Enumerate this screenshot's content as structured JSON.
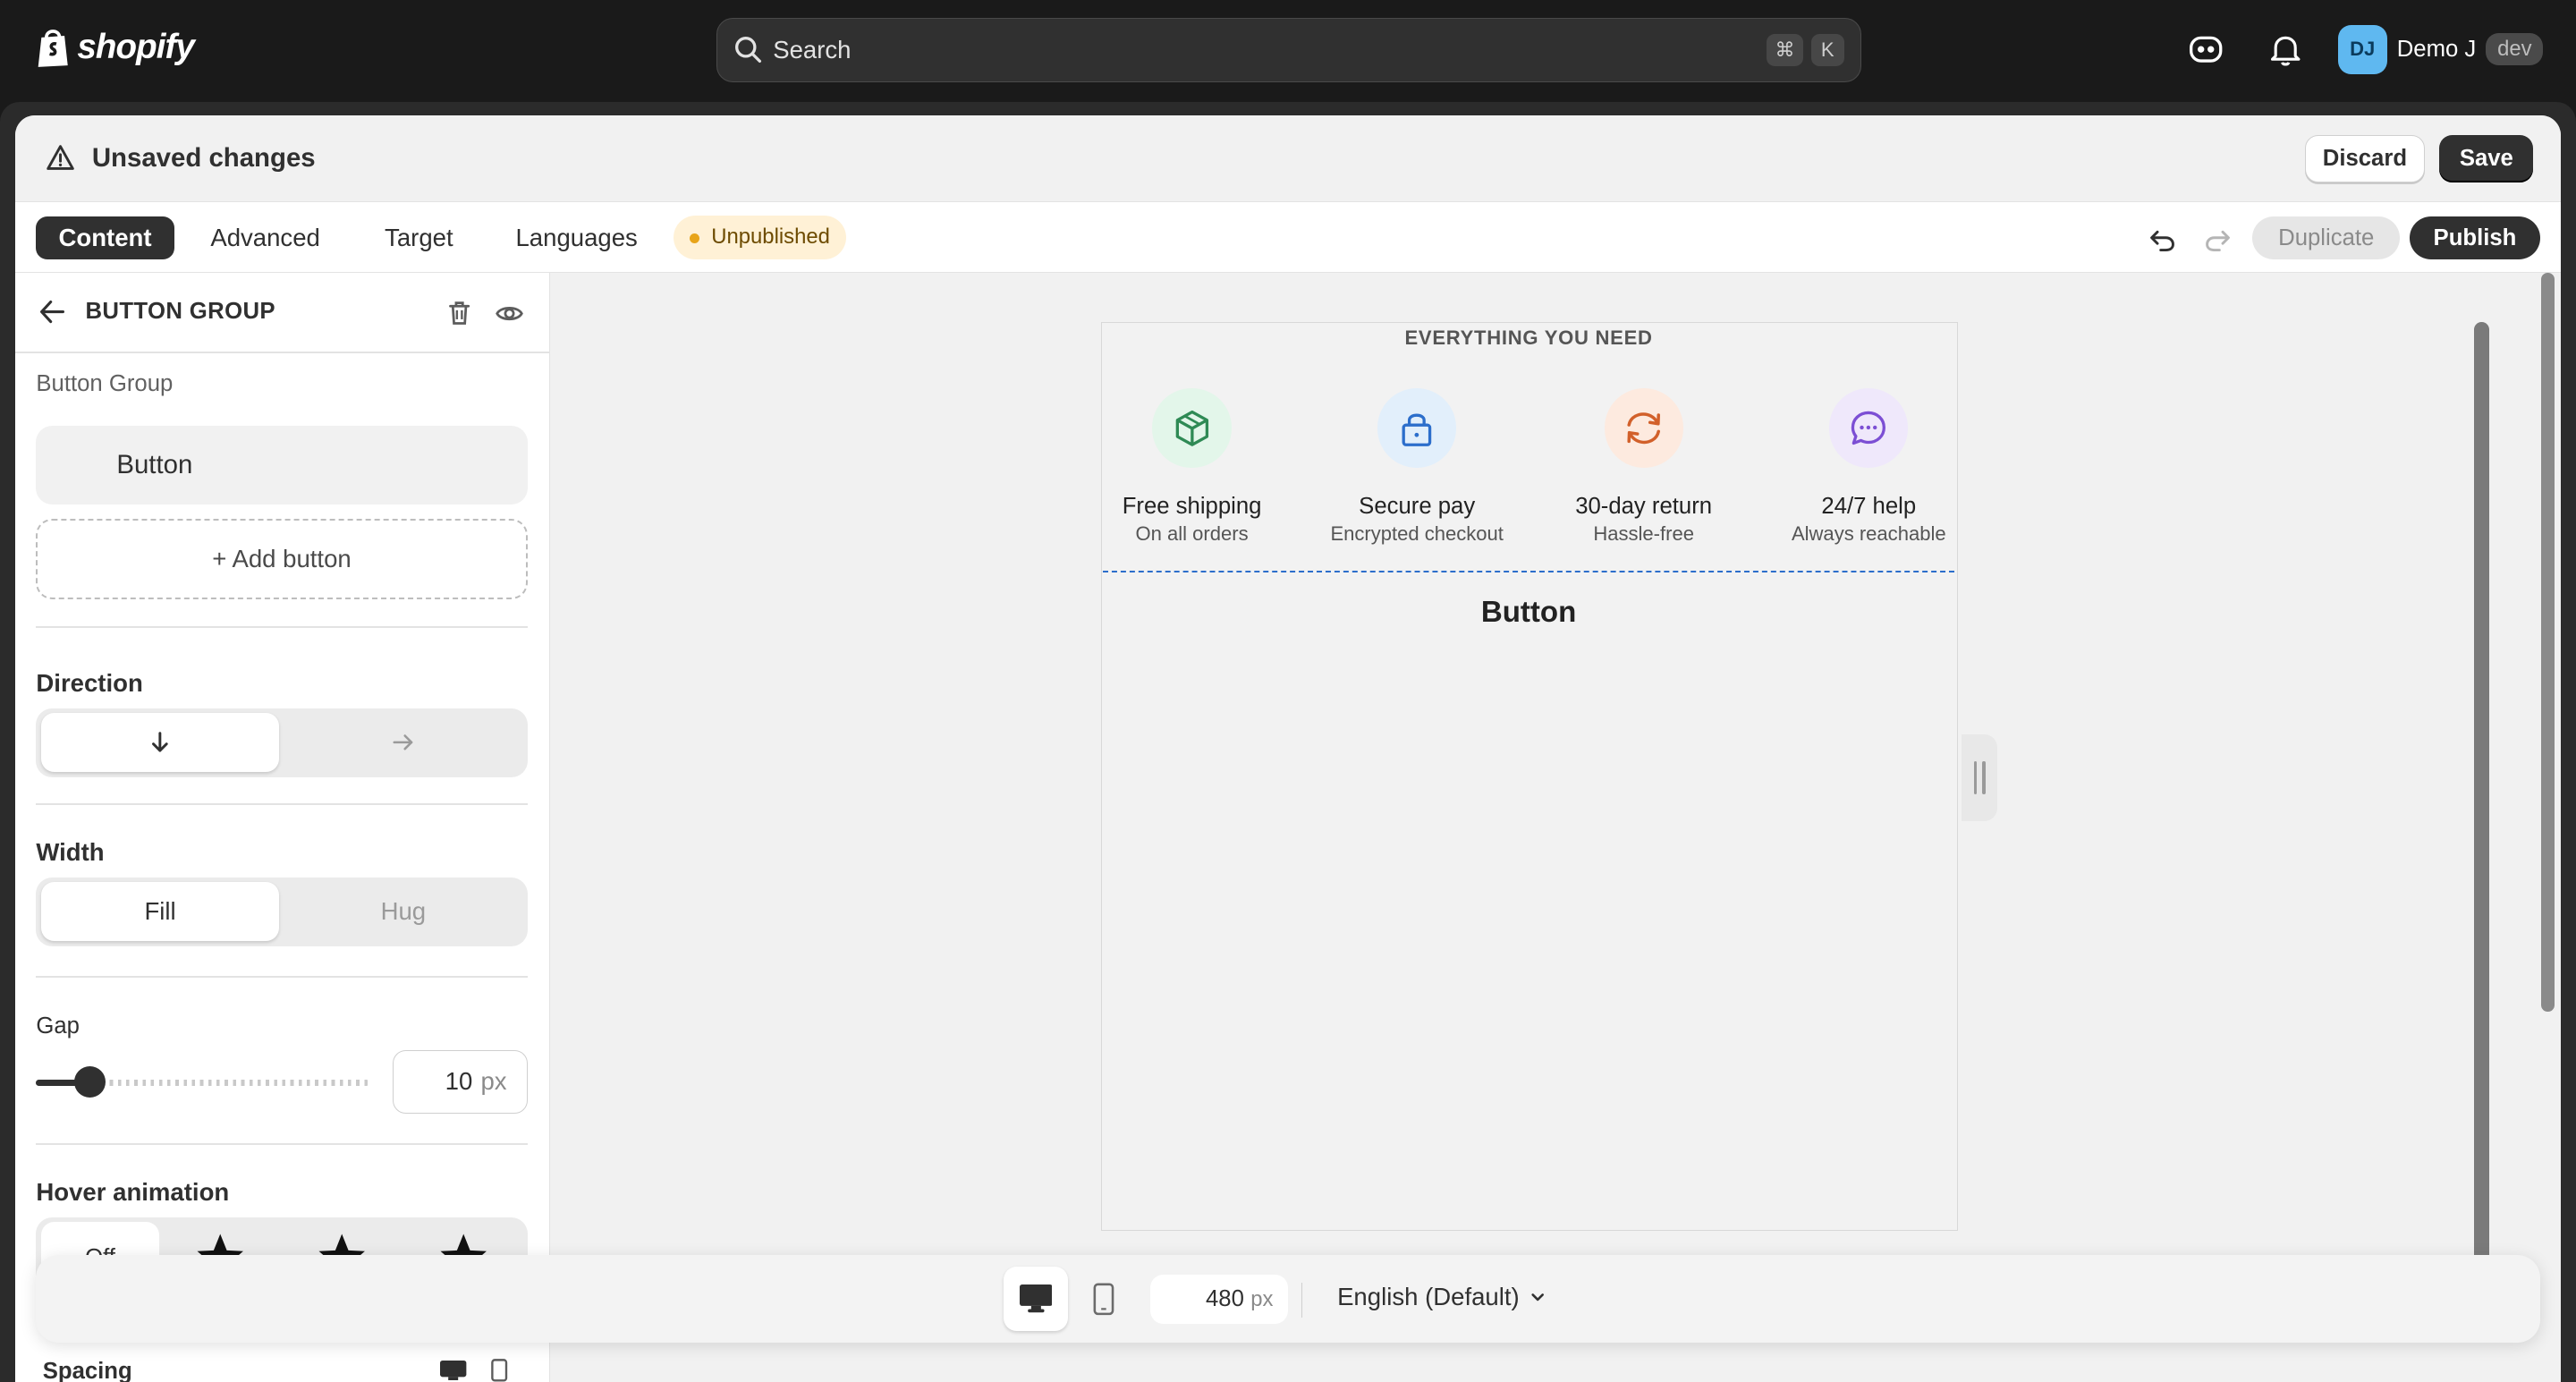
{
  "topbar": {
    "logo_text": "shopify",
    "search_placeholder": "Search",
    "shortcut_keys": [
      "⌘",
      "K"
    ],
    "user_initials": "DJ",
    "user_name": "Demo J",
    "env_badge": "dev",
    "icons": [
      "shopify-bag-icon",
      "search-icon",
      "sidekick-icon",
      "bell-icon"
    ]
  },
  "header": {
    "title": "Unsaved changes",
    "discard_label": "Discard",
    "save_label": "Save"
  },
  "tabs": [
    {
      "label": "Content",
      "active": true
    },
    {
      "label": "Advanced",
      "active": false
    },
    {
      "label": "Target",
      "active": false
    },
    {
      "label": "Languages",
      "active": false
    }
  ],
  "status_pill": "Unpublished",
  "actions": {
    "duplicate_label": "Duplicate",
    "publish_label": "Publish"
  },
  "panel": {
    "title": "BUTTON GROUP",
    "section_label": "Button Group",
    "button_item": "Button",
    "add_button": "+ Add button",
    "direction_label": "Direction",
    "direction_options": [
      "↓",
      "→"
    ],
    "direction_selected": "↓",
    "width_label": "Width",
    "width_options": [
      "Fill",
      "Hug"
    ],
    "width_selected": "Fill",
    "gap_label": "Gap",
    "gap_value": "10",
    "gap_unit": "px",
    "hover_label": "Hover animation",
    "hover_off_label": "Off",
    "spacing_label": "Spacing"
  },
  "preview": {
    "eyebrow": "EVERYTHING YOU NEED",
    "features": [
      {
        "title": "Free shipping",
        "subtitle": "On all orders",
        "icon": "package-icon",
        "bg": "#e3f6ea",
        "fg": "#2f8a55"
      },
      {
        "title": "Secure pay",
        "subtitle": "Encrypted checkout",
        "icon": "lock-icon",
        "bg": "#e2effb",
        "fg": "#2c6ecb"
      },
      {
        "title": "30-day return",
        "subtitle": "Hassle-free",
        "icon": "refresh-icon",
        "bg": "#fdeadf",
        "fg": "#d2602a"
      },
      {
        "title": "24/7 help",
        "subtitle": "Always reachable",
        "icon": "chat-icon",
        "bg": "#efe8fb",
        "fg": "#7c4fd4"
      }
    ],
    "button_text": "Button"
  },
  "bottombar": {
    "width_value": "480",
    "width_unit": "px",
    "language": "English (Default)"
  }
}
